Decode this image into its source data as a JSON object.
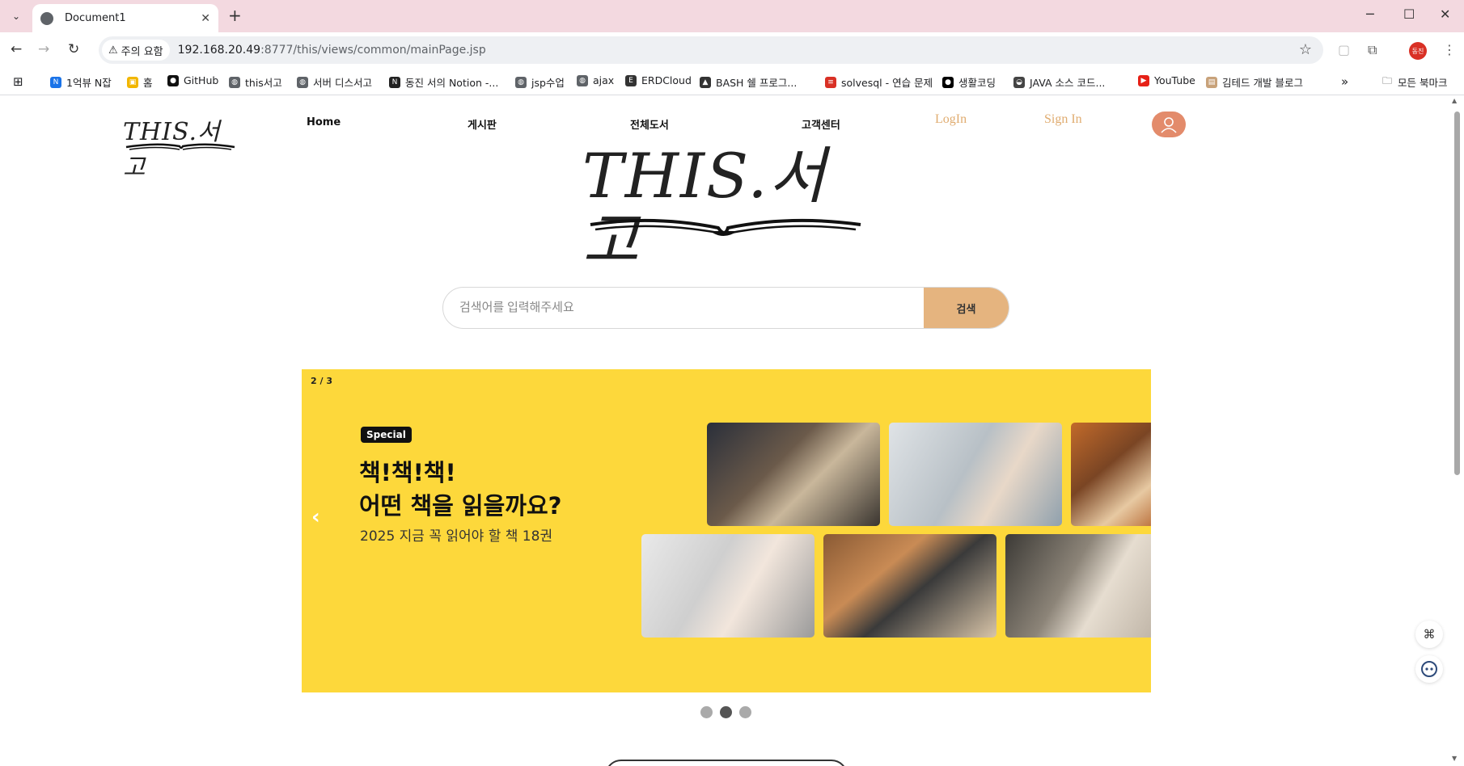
{
  "browser": {
    "tab": {
      "title": "Document1"
    },
    "new_tab_symbol": "+",
    "controls": {
      "minimize": "─",
      "maximize": "☐",
      "close": "✕"
    },
    "omnibox": {
      "security_label": "주의 요함",
      "url_host": "192.168.20.49",
      "url_path": ":8777/this/views/common/mainPage.jsp"
    },
    "profile_label": "동진",
    "bookmarks": [
      {
        "label": "1억뷰 N잡",
        "icon_color": "#1a73e8",
        "icon_glyph": "N"
      },
      {
        "label": "홈",
        "icon_color": "#f2b600",
        "icon_glyph": "▣"
      },
      {
        "label": "GitHub",
        "icon_color": "#111111",
        "icon_glyph": "●"
      },
      {
        "label": "this서고",
        "icon_color": "#5f6368",
        "icon_glyph": "◍"
      },
      {
        "label": "서버 디스서고",
        "icon_color": "#5f6368",
        "icon_glyph": "◍"
      },
      {
        "label": "동진 서의 Notion -...",
        "icon_color": "#222222",
        "icon_glyph": "N"
      },
      {
        "label": "jsp수업",
        "icon_color": "#5f6368",
        "icon_glyph": "◍"
      },
      {
        "label": "ajax",
        "icon_color": "#5f6368",
        "icon_glyph": "◍"
      },
      {
        "label": "ERDCloud",
        "icon_color": "#333333",
        "icon_glyph": "E"
      },
      {
        "label": "BASH 쉘 프로그...",
        "icon_color": "#333333",
        "icon_glyph": "▲"
      },
      {
        "label": "solvesql - 연습 문제",
        "icon_color": "#d93025",
        "icon_glyph": "≡"
      },
      {
        "label": "생활코딩",
        "icon_color": "#000000",
        "icon_glyph": "●"
      },
      {
        "label": "JAVA 소스 코드...",
        "icon_color": "#444444",
        "icon_glyph": "◒"
      },
      {
        "label": "YouTube",
        "icon_color": "#e62117",
        "icon_glyph": "▶"
      },
      {
        "label": "김테드 개발 블로그",
        "icon_color": "#c8a27a",
        "icon_glyph": "▤"
      }
    ],
    "more_bookmarks": "»",
    "all_bookmarks": "모든 북마크"
  },
  "site": {
    "logo_text": "THIS.서고",
    "nav": {
      "home": "Home",
      "board": "게시판",
      "all_books": "전체도서",
      "support": "고객센터",
      "login": "LogIn",
      "signin": "Sign In"
    },
    "search": {
      "placeholder": "검색어를 입력해주세요",
      "button": "검색"
    },
    "banner": {
      "counter": "2 / 3",
      "tag": "Special",
      "heading_line1": "책!책!책!",
      "heading_line2": "어떤 책을 읽을까요?",
      "subtitle": "2025 지금 꼭 읽어야 할 책 18권",
      "prev_arrow": "‹",
      "next_arrow": "›",
      "active_slide": 2,
      "total_slides": 3
    }
  },
  "colors": {
    "tab_strip": "#f3d9e0",
    "banner_bg": "#fdd83b",
    "search_button": "#e5b47f",
    "login_text": "#e0ac70",
    "avatar_bg": "#e38b6b"
  },
  "icons": [
    "back-icon",
    "forward-icon",
    "reload-icon",
    "warning-icon",
    "star-icon",
    "extension-icon",
    "apps-grid-icon",
    "folder-icon",
    "user-icon",
    "chevron-left-icon",
    "chevron-right-icon",
    "shortcut-icon",
    "chatbot-icon"
  ]
}
